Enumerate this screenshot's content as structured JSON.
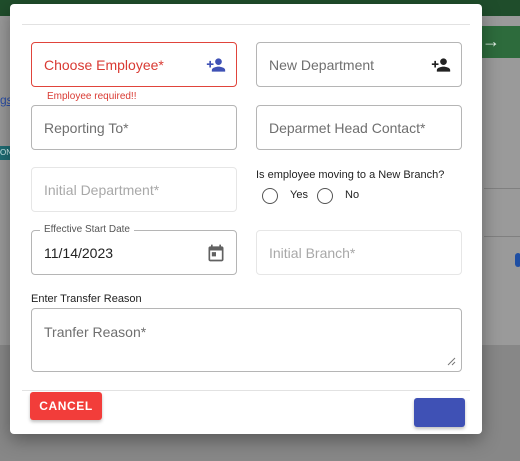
{
  "background": {
    "link_text": "gs",
    "badge_text": "ON"
  },
  "form": {
    "choose_employee": {
      "label": "Choose Employee*",
      "error": "Employee required!!"
    },
    "new_department": {
      "label": "New Department"
    },
    "reporting_to": {
      "label": "Reporting To*"
    },
    "department_head_contact": {
      "label": "Deparmet Head Contact*"
    },
    "initial_department": {
      "label": "Initial Department*"
    },
    "moving_question": "Is employee moving to a New Branch?",
    "radio_yes": "Yes",
    "radio_no": "No",
    "effective_start_date": {
      "label": "Effective Start Date",
      "value": "11/14/2023"
    },
    "initial_branch": {
      "label": "Initial Branch*"
    },
    "transfer_reason_section": "Enter Transfer Reason",
    "transfer_reason": {
      "placeholder": "Tranfer Reason*"
    }
  },
  "actions": {
    "cancel_label": "CANCEL",
    "submit_label": ""
  },
  "colors": {
    "error": "#d93a33",
    "primary": "#3f51b5",
    "cancel": "#f23d3a"
  },
  "icons": {
    "choose_employee": "person-add-icon",
    "new_department": "person-add-icon",
    "date": "calendar-icon",
    "resize": "resize-handle-icon"
  }
}
